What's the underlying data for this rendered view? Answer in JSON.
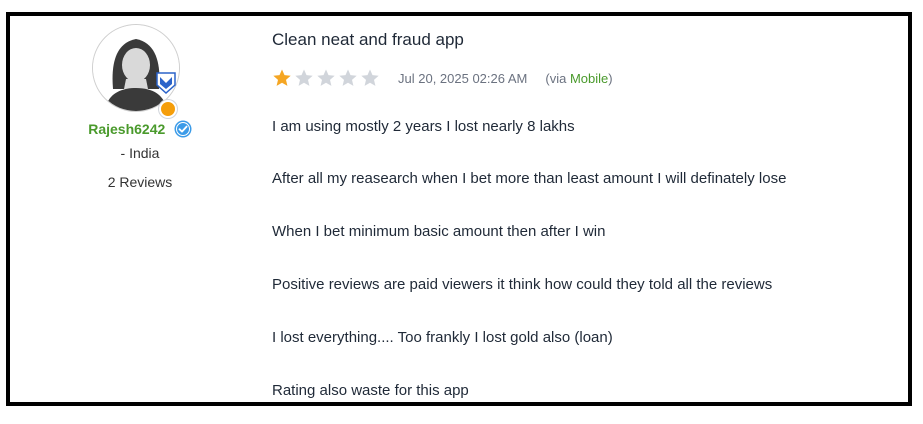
{
  "reviewer": {
    "username": "Rajesh6242",
    "country": "- India",
    "reviews_count": "2 Reviews",
    "verified_icon": "verified-check-icon",
    "colors": {
      "username": "#4a9a2c",
      "verified": "#3b9be8",
      "badge_dot": "#f59e0b",
      "badge_shield": "#2b63c9"
    }
  },
  "review": {
    "title": "Clean neat and fraud app",
    "rating": 1,
    "max_rating": 5,
    "star_colors": {
      "filled": "#f5a623",
      "empty": "#d1d5db"
    },
    "date": "Jul 20, 2025 02:26 AM",
    "via_prefix": "(via ",
    "via_source": "Mobile",
    "via_suffix": ")",
    "paragraphs": [
      "I am using mostly 2 years I lost nearly 8 lakhs",
      "After all my reasearch when I bet more than least amount I will definately lose",
      "When I bet minimum basic amount then after I win",
      "Positive reviews are paid viewers it think how could they told all the reviews",
      "I lost everything.... Too frankly I lost gold also (loan)",
      "Rating also waste for this app"
    ]
  }
}
